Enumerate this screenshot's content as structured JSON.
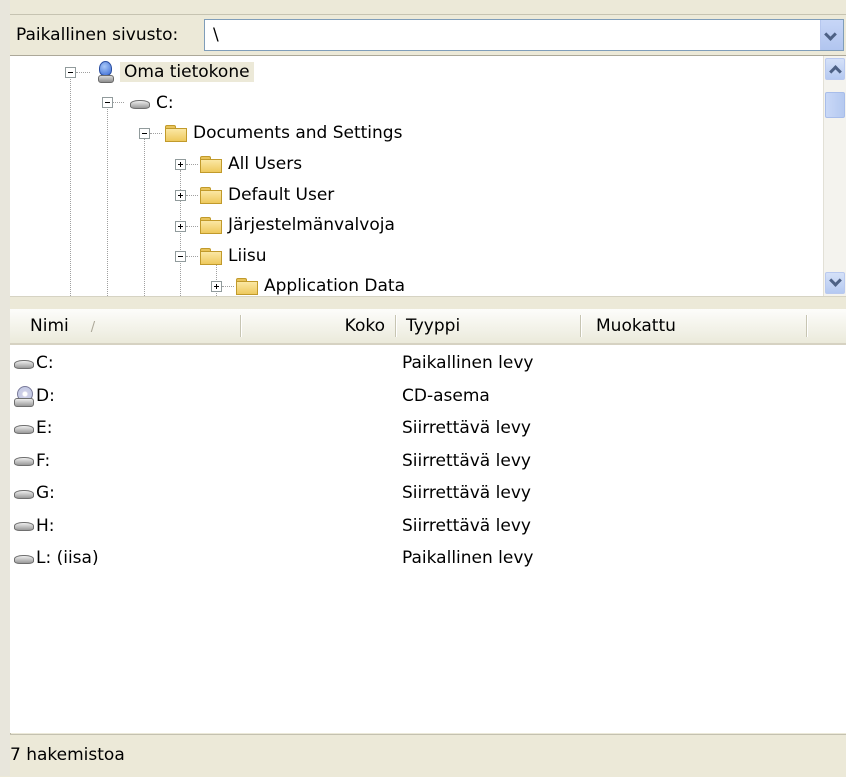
{
  "address": {
    "label": "Paikallinen sivusto:",
    "value": "\\"
  },
  "tree": {
    "nodes": [
      {
        "label": "Oma tietokone",
        "icon": "computer-icon",
        "expanded": true,
        "selected": true
      },
      {
        "label": "C:",
        "icon": "drive-icon",
        "expanded": true
      },
      {
        "label": "Documents and Settings",
        "icon": "folder-icon",
        "expanded": true
      },
      {
        "label": "All Users",
        "icon": "folder-icon",
        "expanded": false
      },
      {
        "label": "Default User",
        "icon": "folder-icon",
        "expanded": false
      },
      {
        "label": "Järjestelmänvalvoja",
        "icon": "folder-icon",
        "expanded": false
      },
      {
        "label": "Liisu",
        "icon": "folder-icon",
        "expanded": true
      },
      {
        "label": "Application Data",
        "icon": "folder-icon",
        "expanded": false
      }
    ]
  },
  "list": {
    "columns": {
      "name": "Nimi",
      "size": "Koko",
      "type": "Tyyppi",
      "modified": "Muokattu"
    },
    "sort_indicator": "/",
    "rows": [
      {
        "name": "C:",
        "type": "Paikallinen levy",
        "icon": "drive-icon"
      },
      {
        "name": "D:",
        "type": "CD-asema",
        "icon": "cd-drive-icon"
      },
      {
        "name": "E:",
        "type": "Siirrettävä levy",
        "icon": "drive-icon"
      },
      {
        "name": "F:",
        "type": "Siirrettävä levy",
        "icon": "drive-icon"
      },
      {
        "name": "G:",
        "type": "Siirrettävä levy",
        "icon": "drive-icon"
      },
      {
        "name": "H:",
        "type": "Siirrettävä levy",
        "icon": "drive-icon"
      },
      {
        "name": "L: (iisa)",
        "type": "Paikallinen levy",
        "icon": "drive-icon"
      }
    ]
  },
  "status": {
    "text": "7 hakemistoa"
  },
  "colors": {
    "chrome": "#ece9d8",
    "folder": "#eec95d",
    "scrollbar": "#b5c9f1"
  }
}
